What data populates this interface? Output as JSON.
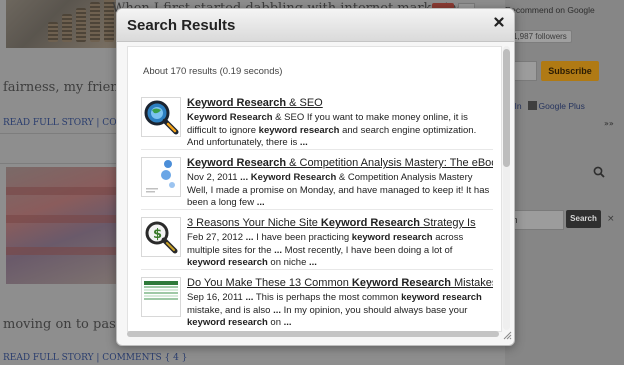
{
  "background_page": {
    "post1_title": "When I first started dabbling with internet marketing",
    "post1_excerpt": "fairness, my friends and",
    "post1_links": "READ FULL STORY | COMMENT",
    "post2_excerpt": "moving on to pastures r",
    "post2_links": "READ FULL STORY | COMMENTS { 4 }",
    "sidebar": {
      "recommend_text": "Recommend on Google",
      "followers_text": "1,987 followers",
      "subscribe_label": "Subscribe",
      "social_links": "edIn",
      "google_plus_label": "Google Plus",
      "arrows": "»»",
      "search_value": "ch",
      "search_button": "Search",
      "search_clear": "×"
    }
  },
  "modal": {
    "title": "Search Results",
    "close_icon": "close-icon",
    "summary": "About 170 results (0.19 seconds)",
    "results": [
      {
        "title_plain_before": "",
        "title_bold": "Keyword Research",
        "title_plain_after": " & SEO",
        "snippet_html_parts": [
          {
            "t": "Keyword Research",
            "b": true
          },
          {
            "t": " & SEO If you want to make money online, it is difficult to ignore ",
            "b": false
          },
          {
            "t": "keyword research",
            "b": true
          },
          {
            "t": " and search engine optimization. And unfortunately, there is ",
            "b": false
          },
          {
            "t": "...",
            "b": true
          }
        ],
        "thumb_icon": "magnifier-globe-icon"
      },
      {
        "title_plain_before": "",
        "title_bold": "Keyword Research",
        "title_plain_after": " & Competition Analysis Mastery: The eBook",
        "snippet_html_parts": [
          {
            "t": "Nov 2, 2011 ",
            "b": false
          },
          {
            "t": "...",
            "b": true
          },
          {
            "t": " ",
            "b": false
          },
          {
            "t": "Keyword Research",
            "b": true
          },
          {
            "t": " & Competition Analysis Mastery Well, I made a promise on Monday, and have managed to keep it! It has been a long few ",
            "b": false
          },
          {
            "t": "...",
            "b": true
          }
        ],
        "thumb_icon": "ebook-cover-icon"
      },
      {
        "title_plain_before": "3 Reasons Your Niche Site ",
        "title_bold": "Keyword Research",
        "title_plain_after": " Strategy Is",
        "snippet_html_parts": [
          {
            "t": "Feb 27, 2012 ",
            "b": false
          },
          {
            "t": "...",
            "b": true
          },
          {
            "t": " I have been practicing ",
            "b": false
          },
          {
            "t": "keyword research",
            "b": true
          },
          {
            "t": " across multiple sites for the ",
            "b": false
          },
          {
            "t": "...",
            "b": true
          },
          {
            "t": " Most recently, I have been doing a lot of ",
            "b": false
          },
          {
            "t": "keyword research",
            "b": true
          },
          {
            "t": " on niche ",
            "b": false
          },
          {
            "t": "...",
            "b": true
          }
        ],
        "thumb_icon": "magnifier-dollar-icon"
      },
      {
        "title_plain_before": "Do You Make These 13 Common ",
        "title_bold": "Keyword Research",
        "title_plain_after": " Mistakes?",
        "snippet_html_parts": [
          {
            "t": "Sep 16, 2011 ",
            "b": false
          },
          {
            "t": "...",
            "b": true
          },
          {
            "t": " This is perhaps the most common ",
            "b": false
          },
          {
            "t": "keyword research",
            "b": true
          },
          {
            "t": " mistake, and is also ",
            "b": false
          },
          {
            "t": "...",
            "b": true
          },
          {
            "t": " In my opinion, you should always base your ",
            "b": false
          },
          {
            "t": "keyword research",
            "b": true
          },
          {
            "t": " on ",
            "b": false
          },
          {
            "t": "...",
            "b": true
          }
        ],
        "thumb_icon": "spreadsheet-icon"
      }
    ]
  }
}
